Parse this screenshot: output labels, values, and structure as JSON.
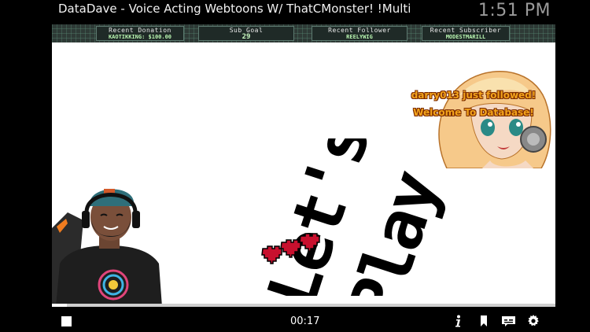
{
  "window": {
    "title": "DataDave - Voice Acting Webtoons W/ ThatCMonster! !Multi",
    "clock": "1:51 PM"
  },
  "overlay_panel": {
    "boxes": [
      {
        "label": "Recent Donation",
        "value": "KAOTIKKING: $100.00"
      },
      {
        "label": "Sub Goal",
        "value": "29"
      },
      {
        "label": "Recent Follower",
        "value": "REELYWIG"
      },
      {
        "label": "Recent Subscriber",
        "value": "MODESTMARILL"
      }
    ]
  },
  "alert": {
    "line1": "darry013 just followed!",
    "line2": "Welcome To Database!"
  },
  "logo": {
    "line1": "Let's",
    "line2": "Play"
  },
  "player": {
    "elapsed": "00:17",
    "progress_fraction": 0.03
  },
  "icons": {
    "stop": "stop-icon",
    "info": "info-icon",
    "bookmark": "bookmark-icon",
    "subtitles": "subtitles-icon",
    "settings": "gear-icon"
  },
  "colors": {
    "alert_text": "#f3a31b",
    "panel_bg": "#2e3a36",
    "panel_value": "#b8f5b0",
    "heart": "#c8102e"
  }
}
